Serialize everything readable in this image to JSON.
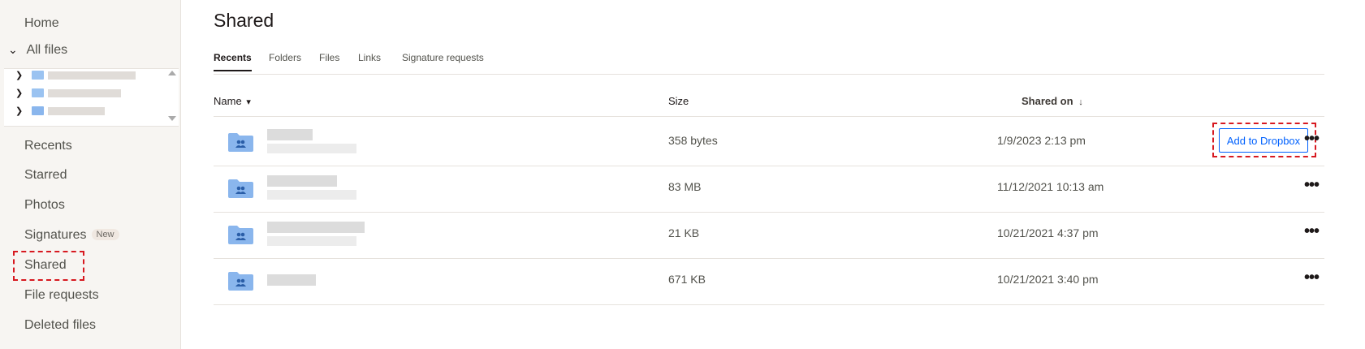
{
  "sidebar": {
    "home": "Home",
    "all_files": "All files",
    "recents": "Recents",
    "starred": "Starred",
    "photos": "Photos",
    "signatures": "Signatures",
    "signatures_badge": "New",
    "shared": "Shared",
    "file_requests": "File requests",
    "deleted_files": "Deleted files"
  },
  "page": {
    "title": "Shared"
  },
  "tabs": [
    "Recents",
    "Folders",
    "Files",
    "Links",
    "Signature requests"
  ],
  "table": {
    "headers": {
      "name": "Name",
      "size": "Size",
      "shared_on": "Shared on"
    },
    "rows": [
      {
        "size": "358 bytes",
        "shared_on": "1/9/2023 2:13 pm"
      },
      {
        "size": "83 MB",
        "shared_on": "11/12/2021 10:13 am"
      },
      {
        "size": "21 KB",
        "shared_on": "10/21/2021 4:37 pm"
      },
      {
        "size": "671 KB",
        "shared_on": "10/21/2021 3:40 pm"
      }
    ],
    "add_button": "Add to Dropbox",
    "more_icon": "•••"
  },
  "icons": {
    "sort_down": "▾",
    "sort_arrow": "↓",
    "chevron_down": "⌄",
    "chevron_right": "›"
  },
  "colors": {
    "accent": "#0061fe",
    "highlight": "#d71920",
    "folder": "#8ab6ed"
  }
}
